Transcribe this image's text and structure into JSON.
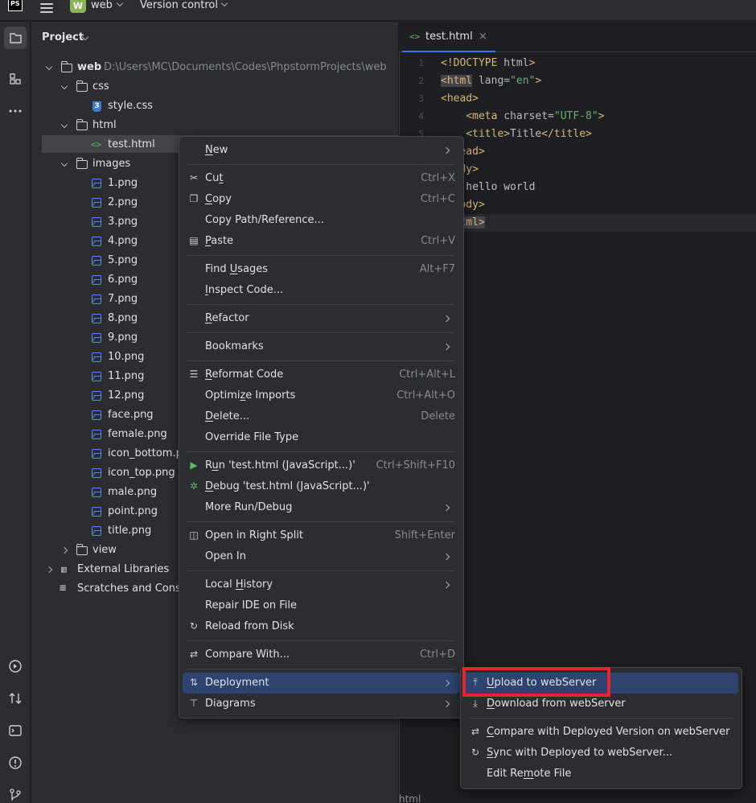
{
  "titlebar": {
    "logo_text": "PS",
    "project_badge": "W",
    "project_name": "web",
    "vcs_label": "Version control"
  },
  "project_panel": {
    "header": "Project",
    "tree": [
      {
        "label": "web",
        "path": "D:\\Users\\MC\\Documents\\Codes\\PhpstormProjects\\web",
        "type": "folder",
        "expanded": true
      },
      {
        "label": "css",
        "type": "folder",
        "expanded": true
      },
      {
        "label": "style.css",
        "type": "css"
      },
      {
        "label": "html",
        "type": "folder",
        "expanded": true
      },
      {
        "label": "test.html",
        "type": "html",
        "selected": true
      },
      {
        "label": "images",
        "type": "folder",
        "expanded": true
      },
      {
        "label": "1.png",
        "type": "image"
      },
      {
        "label": "2.png",
        "type": "image"
      },
      {
        "label": "3.png",
        "type": "image"
      },
      {
        "label": "4.png",
        "type": "image"
      },
      {
        "label": "5.png",
        "type": "image"
      },
      {
        "label": "6.png",
        "type": "image"
      },
      {
        "label": "7.png",
        "type": "image"
      },
      {
        "label": "8.png",
        "type": "image"
      },
      {
        "label": "9.png",
        "type": "image"
      },
      {
        "label": "10.png",
        "type": "image"
      },
      {
        "label": "11.png",
        "type": "image"
      },
      {
        "label": "12.png",
        "type": "image"
      },
      {
        "label": "face.png",
        "type": "image"
      },
      {
        "label": "female.png",
        "type": "image"
      },
      {
        "label": "icon_bottom.pr",
        "type": "image"
      },
      {
        "label": "icon_top.png",
        "type": "image"
      },
      {
        "label": "male.png",
        "type": "image"
      },
      {
        "label": "point.png",
        "type": "image"
      },
      {
        "label": "title.png",
        "type": "image"
      },
      {
        "label": "view",
        "type": "folder",
        "expanded": false
      },
      {
        "label": "External Libraries",
        "type": "library",
        "expanded": false
      },
      {
        "label": "Scratches and Consc",
        "type": "scratches"
      }
    ]
  },
  "editor": {
    "tab_label": "test.html",
    "tab_icon": "<>",
    "tab_close": "×",
    "line_numbers": [
      "1",
      "2",
      "3",
      "4",
      "5"
    ],
    "status_text": "html"
  },
  "context_menu": {
    "items": [
      {
        "label": "New",
        "mnemonic_index": 0,
        "submenu": true
      },
      {
        "separator": true
      },
      {
        "label": "Cut",
        "mnemonic_index": 2,
        "shortcut": "Ctrl+X",
        "icon": "scissors-icon"
      },
      {
        "label": "Copy",
        "mnemonic_index": 0,
        "shortcut": "Ctrl+C",
        "icon": "copy-icon"
      },
      {
        "label": "Copy Path/Reference...",
        "mnemonic_index": -1
      },
      {
        "label": "Paste",
        "mnemonic_index": 0,
        "shortcut": "Ctrl+V",
        "icon": "paste-icon"
      },
      {
        "separator": true
      },
      {
        "label": "Find Usages",
        "mnemonic_index": 5,
        "shortcut": "Alt+F7"
      },
      {
        "label": "Inspect Code...",
        "mnemonic_index": 0
      },
      {
        "separator": true
      },
      {
        "label": "Refactor",
        "mnemonic_index": 0,
        "submenu": true
      },
      {
        "separator": true
      },
      {
        "label": "Bookmarks",
        "mnemonic_index": -1,
        "submenu": true
      },
      {
        "separator": true
      },
      {
        "label": "Reformat Code",
        "mnemonic_index": 0,
        "shortcut": "Ctrl+Alt+L",
        "icon": "reformat-icon"
      },
      {
        "label": "Optimize Imports",
        "mnemonic_index": 6,
        "shortcut": "Ctrl+Alt+O"
      },
      {
        "label": "Delete...",
        "mnemonic_index": 0,
        "shortcut": "Delete"
      },
      {
        "label": "Override File Type",
        "mnemonic_index": -1
      },
      {
        "separator": true
      },
      {
        "label": "Run 'test.html (JavaScript...)'",
        "mnemonic_index": 1,
        "shortcut": "Ctrl+Shift+F10",
        "icon": "run-icon"
      },
      {
        "label": "Debug 'test.html (JavaScript...)'",
        "mnemonic_index": 0,
        "icon": "debug-icon"
      },
      {
        "label": "More Run/Debug",
        "mnemonic_index": -1,
        "submenu": true
      },
      {
        "separator": true
      },
      {
        "label": "Open in Right Split",
        "mnemonic_index": -1,
        "shortcut": "Shift+Enter",
        "icon": "split-icon"
      },
      {
        "label": "Open In",
        "mnemonic_index": -1,
        "submenu": true
      },
      {
        "separator": true
      },
      {
        "label": "Local History",
        "mnemonic_index": 6,
        "submenu": true
      },
      {
        "label": "Repair IDE on File",
        "mnemonic_index": -1
      },
      {
        "label": "Reload from Disk",
        "mnemonic_index": -1,
        "icon": "reload-icon"
      },
      {
        "separator": true
      },
      {
        "label": "Compare With...",
        "mnemonic_index": -1,
        "shortcut": "Ctrl+D",
        "icon": "compare-icon"
      },
      {
        "separator": true
      },
      {
        "label": "Deployment",
        "mnemonic_index": -1,
        "submenu": true,
        "highlighted": true,
        "icon": "deployment-icon"
      },
      {
        "label": "Diagrams",
        "mnemonic_index": -1,
        "submenu": true,
        "icon": "diagram-icon"
      }
    ]
  },
  "deployment_submenu": {
    "items": [
      {
        "label": "Upload to webServer",
        "mnemonic_index": 0,
        "highlighted": true,
        "icon": "upload-icon"
      },
      {
        "label": "Download from webServer",
        "mnemonic_index": 0,
        "icon": "download-icon"
      },
      {
        "separator": true
      },
      {
        "label": "Compare with Deployed Version on webServer",
        "mnemonic_index": 0,
        "icon": "compare-icon"
      },
      {
        "label": "Sync with Deployed to webServer...",
        "mnemonic_index": 0,
        "icon": "sync-icon"
      },
      {
        "label": "Edit Remote File",
        "mnemonic_index": 7
      }
    ]
  },
  "colors": {
    "accent": "#3574f0",
    "highlight": "#2e436e",
    "annotation_red": "#e8232a"
  }
}
